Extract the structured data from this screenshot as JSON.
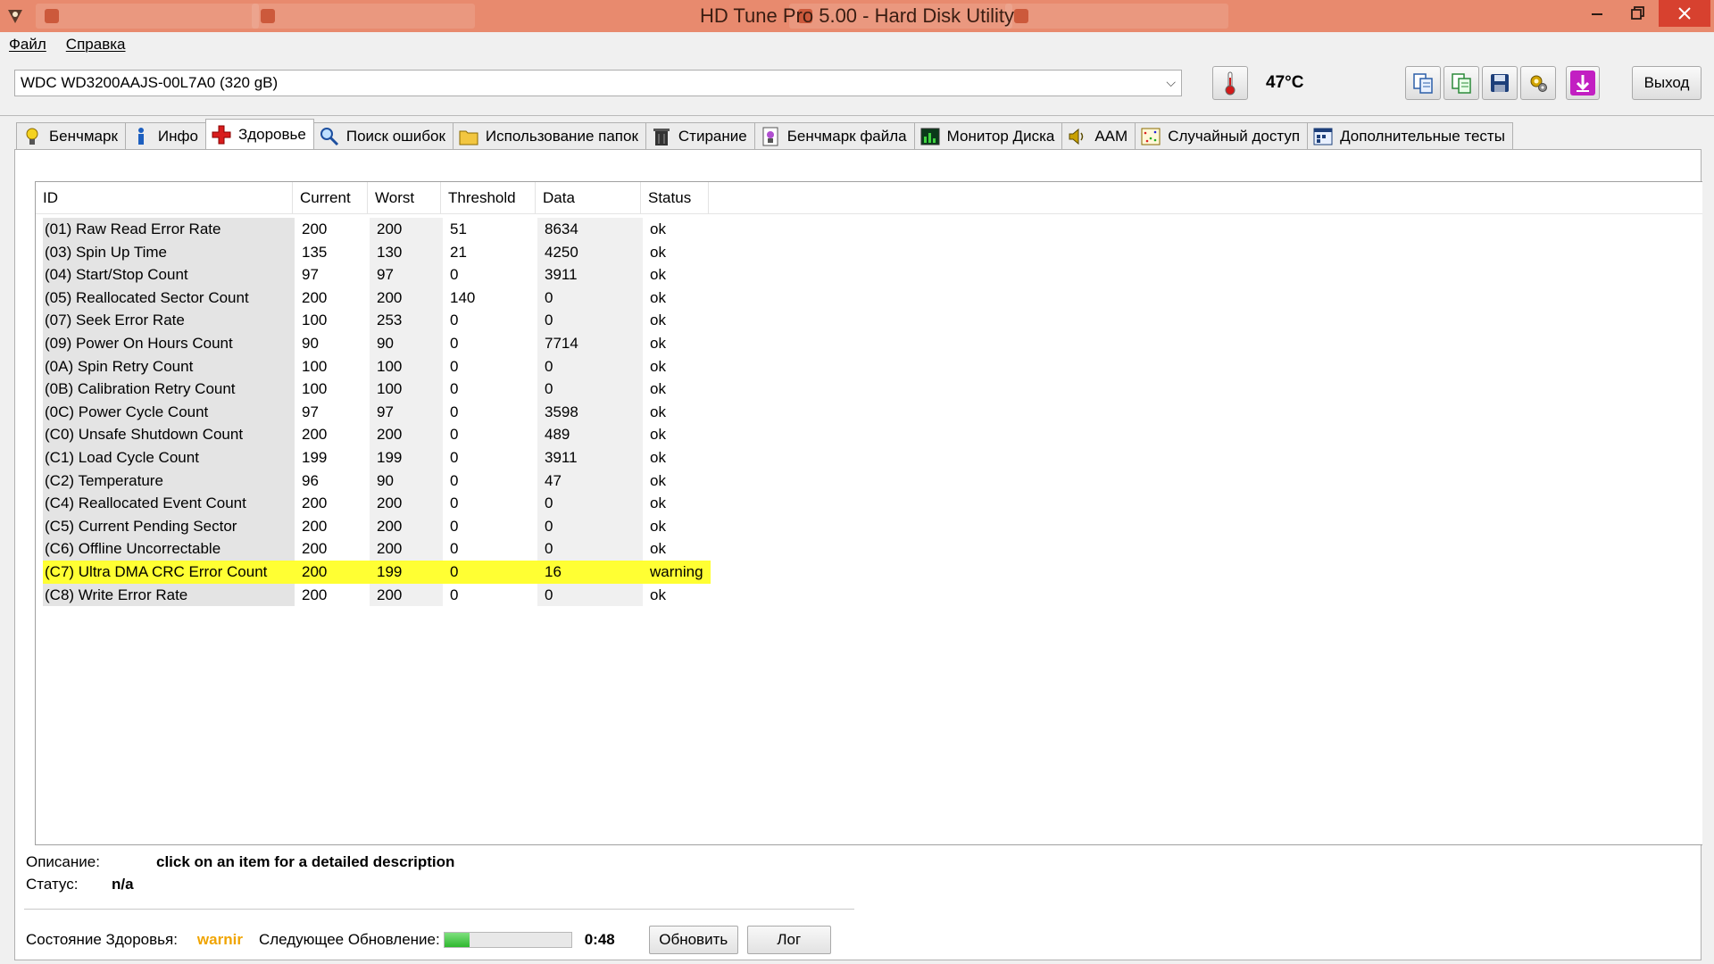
{
  "window": {
    "title": "HD Tune Pro 5.00 - Hard Disk Utility",
    "background_tabs": [
      "",
      "",
      "",
      ""
    ]
  },
  "menu": {
    "items": [
      "Файл",
      "Справка"
    ]
  },
  "toolbar": {
    "drive": "WDC WD3200AAJS-00L7A0 (320 gB)",
    "temperature": "47°C",
    "exit_label": "Выход"
  },
  "tabs": [
    {
      "label": "Бенчмарк",
      "icon": "bulb-icon"
    },
    {
      "label": "Инфо",
      "icon": "info-icon"
    },
    {
      "label": "Здоровье",
      "icon": "health-cross-icon",
      "active": true
    },
    {
      "label": "Поиск ошибок",
      "icon": "magnifier-icon"
    },
    {
      "label": "Использование папок",
      "icon": "folder-icon"
    },
    {
      "label": "Стирание",
      "icon": "trash-icon"
    },
    {
      "label": "Бенчмарк файла",
      "icon": "file-benchmark-icon"
    },
    {
      "label": "Монитор Диска",
      "icon": "disk-monitor-icon"
    },
    {
      "label": "AAM",
      "icon": "speaker-icon"
    },
    {
      "label": "Случайный доступ",
      "icon": "random-access-icon"
    },
    {
      "label": "Дополнительные тесты",
      "icon": "extra-tests-icon"
    }
  ],
  "smart": {
    "columns": [
      "ID",
      "Current",
      "Worst",
      "Threshold",
      "Data",
      "Status"
    ],
    "rows": [
      {
        "id": "(01) Raw Read Error Rate",
        "current": "200",
        "worst": "200",
        "threshold": "51",
        "data": "8634",
        "status": "ok"
      },
      {
        "id": "(03) Spin Up Time",
        "current": "135",
        "worst": "130",
        "threshold": "21",
        "data": "4250",
        "status": "ok"
      },
      {
        "id": "(04) Start/Stop Count",
        "current": "97",
        "worst": "97",
        "threshold": "0",
        "data": "3911",
        "status": "ok"
      },
      {
        "id": "(05) Reallocated Sector Count",
        "current": "200",
        "worst": "200",
        "threshold": "140",
        "data": "0",
        "status": "ok"
      },
      {
        "id": "(07) Seek Error Rate",
        "current": "100",
        "worst": "253",
        "threshold": "0",
        "data": "0",
        "status": "ok"
      },
      {
        "id": "(09) Power On Hours Count",
        "current": "90",
        "worst": "90",
        "threshold": "0",
        "data": "7714",
        "status": "ok"
      },
      {
        "id": "(0A) Spin Retry Count",
        "current": "100",
        "worst": "100",
        "threshold": "0",
        "data": "0",
        "status": "ok"
      },
      {
        "id": "(0B) Calibration Retry Count",
        "current": "100",
        "worst": "100",
        "threshold": "0",
        "data": "0",
        "status": "ok"
      },
      {
        "id": "(0C) Power Cycle Count",
        "current": "97",
        "worst": "97",
        "threshold": "0",
        "data": "3598",
        "status": "ok"
      },
      {
        "id": "(C0) Unsafe Shutdown Count",
        "current": "200",
        "worst": "200",
        "threshold": "0",
        "data": "489",
        "status": "ok"
      },
      {
        "id": "(C1) Load Cycle Count",
        "current": "199",
        "worst": "199",
        "threshold": "0",
        "data": "3911",
        "status": "ok"
      },
      {
        "id": "(C2) Temperature",
        "current": "96",
        "worst": "90",
        "threshold": "0",
        "data": "47",
        "status": "ok"
      },
      {
        "id": "(C4) Reallocated Event Count",
        "current": "200",
        "worst": "200",
        "threshold": "0",
        "data": "0",
        "status": "ok"
      },
      {
        "id": "(C5) Current Pending Sector",
        "current": "200",
        "worst": "200",
        "threshold": "0",
        "data": "0",
        "status": "ok"
      },
      {
        "id": "(C6) Offline Uncorrectable",
        "current": "200",
        "worst": "200",
        "threshold": "0",
        "data": "0",
        "status": "ok"
      },
      {
        "id": "(C7) Ultra DMA CRC Error Count",
        "current": "200",
        "worst": "199",
        "threshold": "0",
        "data": "16",
        "status": "warning",
        "highlight": true
      },
      {
        "id": "(C8) Write Error Rate",
        "current": "200",
        "worst": "200",
        "threshold": "0",
        "data": "0",
        "status": "ok"
      }
    ],
    "highlight_color": "#ffff33"
  },
  "details": {
    "description_label": "Описание:",
    "description_value": "click on an item for a detailed description",
    "status_label": "Статус:",
    "status_value": "n/a"
  },
  "footer": {
    "health_label": "Состояние Здоровья:",
    "health_value": "warnir",
    "health_color": "#f0a400",
    "next_update_label": "Следующее Обновление:",
    "update_progress": 0.2,
    "countdown": "0:48",
    "refresh_label": "Обновить",
    "log_label": "Лог"
  }
}
